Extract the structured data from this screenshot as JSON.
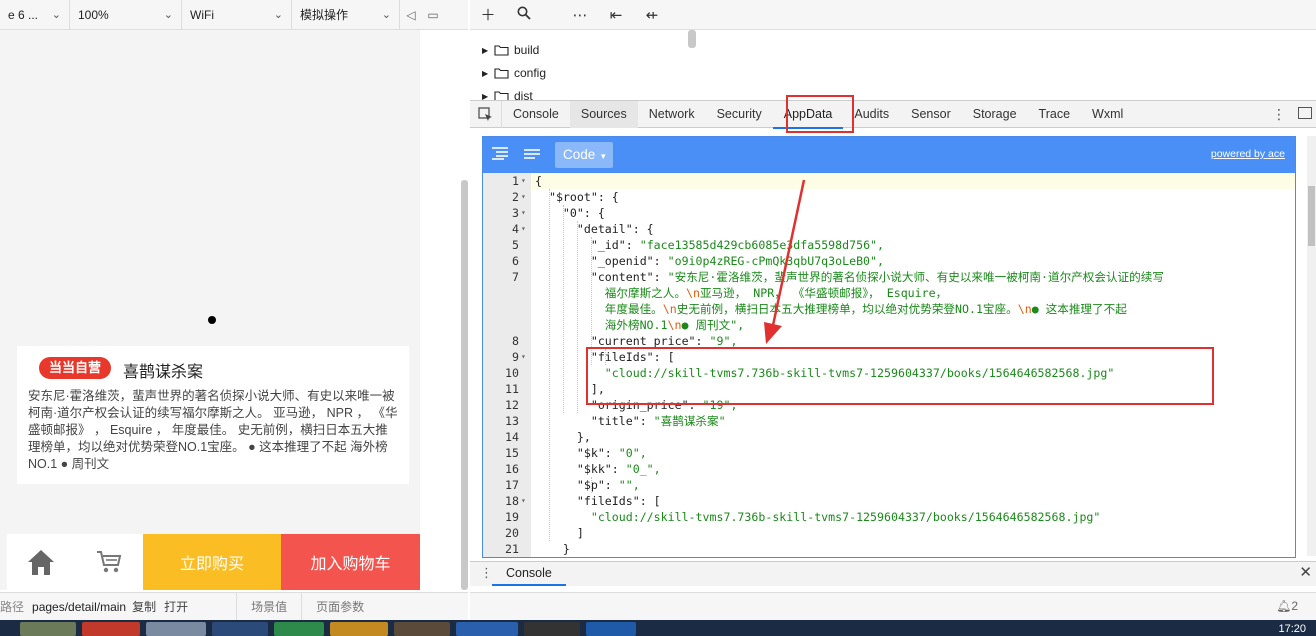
{
  "simulator": {
    "device": "e 6 ...",
    "zoom": "100%",
    "network": "WiFi",
    "operation": "模拟操作",
    "book": {
      "badge": "当当自营",
      "title": "喜鹊谋杀案",
      "description": "安东尼·霍洛维茨，蜚声世界的著名侦探小说大师、有史以来唯一被柯南·道尔产权会认证的续写福尔摩斯之人。 亚马逊， NPR ， 《华盛顿邮报》 ， Esquire ， 年度最佳。 史无前例，横扫日本五大推理榜单，均以绝对优势荣登NO.1宝座。 ● 这本推理了不起 海外榜NO.1 ● 周刊文"
    },
    "bottom_bar": {
      "home_icon": "home-icon",
      "cart_icon": "cart-icon",
      "buy_now": "立即购买",
      "add_to_cart": "加入购物车"
    },
    "status": {
      "path_label": "路径",
      "path": "pages/detail/main",
      "copy": "复制",
      "open": "打开",
      "scene": "场景值",
      "page_params": "页面参数"
    }
  },
  "file_tree": [
    "build",
    "config",
    "dist"
  ],
  "devtools": {
    "tabs": [
      "Console",
      "Sources",
      "Network",
      "Security",
      "AppData",
      "Audits",
      "Sensor",
      "Storage",
      "Trace",
      "Wxml"
    ],
    "active_tab": "AppData"
  },
  "ace": {
    "mode": "Code",
    "powered_by": "powered by ace"
  },
  "console_tab": "Console",
  "code_lines": [
    {
      "n": "1",
      "t": "{"
    },
    {
      "n": "2",
      "t": "  \"$root\": {"
    },
    {
      "n": "3",
      "t": "    \"0\": {"
    },
    {
      "n": "4",
      "t": "      \"detail\": {"
    },
    {
      "n": "5",
      "t": "        \"_id\": \"face13585d429cb6085e3dfa5598d756\","
    },
    {
      "n": "6",
      "t": "        \"_openid\": \"o9i0p4zREG-cPmQk3qbU7q3oLeB0\","
    },
    {
      "n": "7",
      "t": "        \"content\": \"安东尼·霍洛维茨，蜚声世界的著名侦探小说大师、有史以来唯一被柯南·道尔产权会认证的续写"
    },
    {
      "n": "",
      "t": "          福尔摩斯之人。\\n亚马逊， NPR， 《华盛顿邮报》， Esquire，"
    },
    {
      "n": "",
      "t": "          年度最佳。\\n史无前例，横扫日本五大推理榜单，均以绝对优势荣登NO.1宝座。\\n● 这本推理了不起"
    },
    {
      "n": "",
      "t": "          海外榜NO.1\\n● 周刊文\","
    },
    {
      "n": "8",
      "t": "        \"current_price\": \"9\","
    },
    {
      "n": "9",
      "t": "        \"fileIds\": ["
    },
    {
      "n": "10",
      "t": "          \"cloud://skill-tvms7.736b-skill-tvms7-1259604337/books/1564646582568.jpg\""
    },
    {
      "n": "11",
      "t": "        ],"
    },
    {
      "n": "12",
      "t": "        \"origin_price\": \"19\","
    },
    {
      "n": "13",
      "t": "        \"title\": \"喜鹊谋杀案\""
    },
    {
      "n": "14",
      "t": "      },"
    },
    {
      "n": "15",
      "t": "      \"$k\": \"0\","
    },
    {
      "n": "16",
      "t": "      \"$kk\": \"0_\","
    },
    {
      "n": "17",
      "t": "      \"$p\": \"\","
    },
    {
      "n": "18",
      "t": "      \"fileIds\": ["
    },
    {
      "n": "19",
      "t": "        \"cloud://skill-tvms7.736b-skill-tvms7-1259604337/books/1564646582568.jpg\""
    },
    {
      "n": "20",
      "t": "      ]"
    },
    {
      "n": "21",
      "t": "    }"
    }
  ],
  "taskbar": {
    "clock": "17:20",
    "notification_count": "2"
  },
  "colors": {
    "accent": "#1a73e8",
    "ace_toolbar": "#4a8ff5",
    "highlight": "#e03030",
    "buy_now": "#fbbd24",
    "add_to_cart": "#f4544e",
    "badge": "#e8382b"
  }
}
